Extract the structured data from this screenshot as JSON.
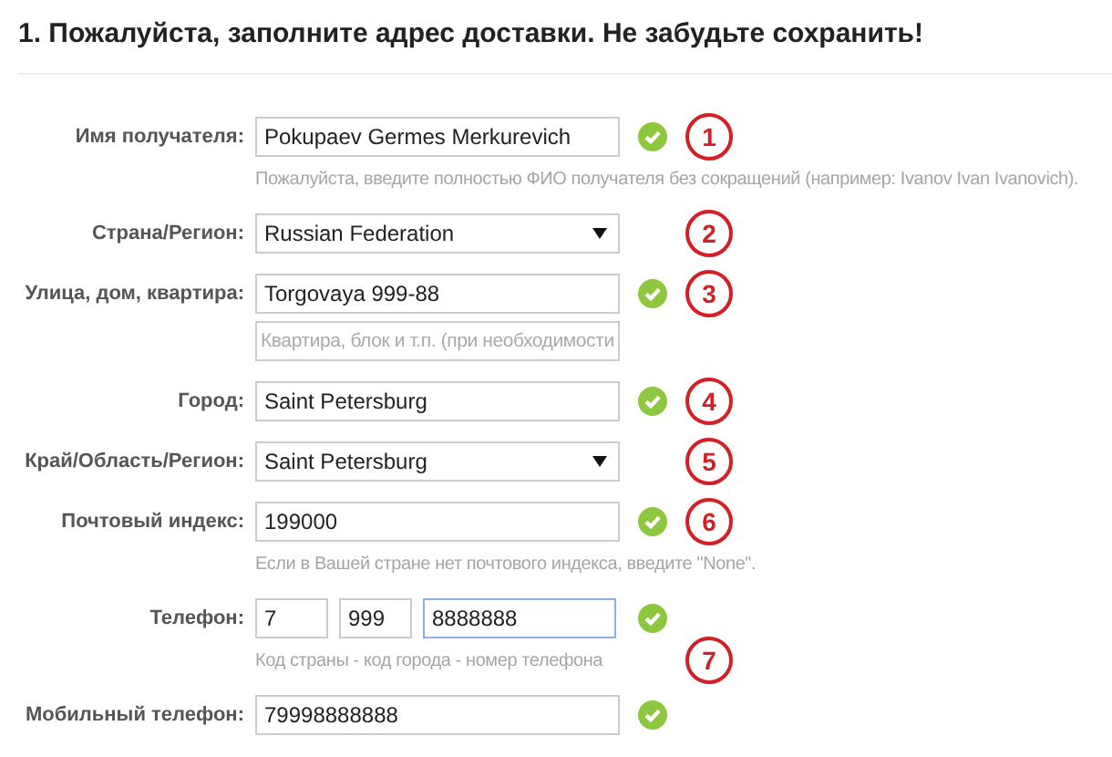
{
  "heading": "1. Пожалуйста, заполните адрес доставки. Не забудьте сохранить!",
  "rows": [
    {
      "kind": "text",
      "label": "Имя получателя:",
      "value": "Pokupaev Germes Merkurevich",
      "valid": true,
      "marker": "1"
    },
    {
      "kind": "hint",
      "text": "Пожалуйста, введите полностью ФИО получателя без сокращений (например: Ivanov Ivan Ivanovich)."
    },
    {
      "kind": "select",
      "label": "Страна/Регион:",
      "value": "Russian Federation",
      "marker": "2"
    },
    {
      "kind": "text",
      "label": "Улица, дом, квартира:",
      "value": "Torgovaya 999-88",
      "valid": true,
      "marker": "3"
    },
    {
      "kind": "extra",
      "placeholder": "Квартира, блок и т.п. (при необходимости"
    },
    {
      "kind": "text",
      "label": "Город:",
      "value": "Saint Petersburg",
      "valid": true,
      "marker": "4"
    },
    {
      "kind": "select",
      "label": "Край/Область/Регион:",
      "value": "Saint Petersburg",
      "marker": "5"
    },
    {
      "kind": "text",
      "label": "Почтовый индекс:",
      "value": "199000",
      "valid": true,
      "marker": "6"
    },
    {
      "kind": "hint",
      "text": "Если в Вашей стране нет почтового индекса, введите \"None\"."
    },
    {
      "kind": "phone",
      "label": "Телефон:",
      "parts": [
        {
          "value": "7",
          "focused": false
        },
        {
          "value": "999",
          "focused": false
        },
        {
          "value": "8888888",
          "focused": true
        }
      ],
      "valid": true
    },
    {
      "kind": "hint",
      "text": "Код страны - код города - номер телефона",
      "marker": "7"
    },
    {
      "kind": "text",
      "label": "Мобильный телефон:",
      "value": "79998888888",
      "valid": true
    }
  ]
}
